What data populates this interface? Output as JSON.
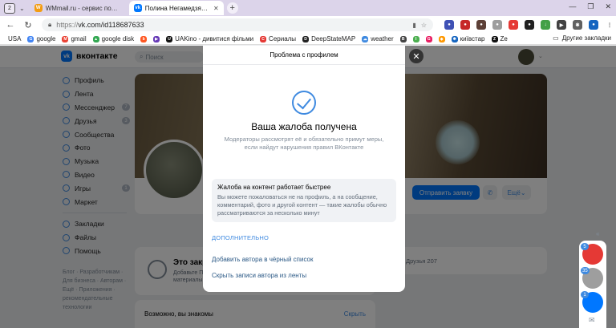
{
  "browser": {
    "tab_count": "2",
    "tabs": [
      {
        "title": "WMmail.ru - сервис почтового маркетинга",
        "fav_color": "#f39c12",
        "fav_glyph": "W"
      },
      {
        "title": "Полина Негамедзянова",
        "fav_color": "#0077ff",
        "fav_glyph": "vk"
      }
    ],
    "window": {
      "minimize": "—",
      "maximize": "❐",
      "close": "✕"
    },
    "address": {
      "prefix": "https://",
      "rest": "vk.com/id118687633"
    },
    "bookmarks": [
      {
        "label": "USA",
        "color": "#ffffff",
        "glyph": ""
      },
      {
        "label": "google",
        "color": "#4285f4",
        "glyph": "G"
      },
      {
        "label": "gmail",
        "color": "#ea4335",
        "glyph": "M"
      },
      {
        "label": "google disk",
        "color": "#34a853",
        "glyph": "▲"
      },
      {
        "label": "",
        "color": "#ff5722",
        "glyph": "b"
      },
      {
        "label": "",
        "color": "#673ab7",
        "glyph": "▶"
      },
      {
        "label": "UAKino - дивитися фільми",
        "color": "#111111",
        "glyph": "U"
      },
      {
        "label": "Сериалы",
        "color": "#e53935",
        "glyph": "С"
      },
      {
        "label": "DeepStateMAP",
        "color": "#222222",
        "glyph": "D"
      },
      {
        "label": "weather",
        "color": "#3f8ae0",
        "glyph": "☁"
      },
      {
        "label": "",
        "color": "#444444",
        "glyph": "B"
      },
      {
        "label": "",
        "color": "#4caf50",
        "glyph": "I"
      },
      {
        "label": "",
        "color": "#e91e63",
        "glyph": "G"
      },
      {
        "label": "",
        "color": "#ff9800",
        "glyph": "◆"
      },
      {
        "label": "",
        "color": "#9e9e9e",
        "glyph": "▣"
      },
      {
        "label": "київстар",
        "color": "#1565c0",
        "glyph": "✱"
      },
      {
        "label": "Ze",
        "color": "#111111",
        "glyph": "Z"
      }
    ],
    "other_bookmarks": "Другие закладки"
  },
  "vk": {
    "logo": "вконтакте",
    "search_placeholder": "Поиск",
    "menu": [
      {
        "label": "Профиль",
        "count": ""
      },
      {
        "label": "Лента",
        "count": ""
      },
      {
        "label": "Мессенджер",
        "count": "7"
      },
      {
        "label": "Друзья",
        "count": "3"
      },
      {
        "label": "Сообщества",
        "count": ""
      },
      {
        "label": "Фото",
        "count": ""
      },
      {
        "label": "Музыка",
        "count": ""
      },
      {
        "label": "Видео",
        "count": ""
      },
      {
        "label": "Игры",
        "count": "1"
      },
      {
        "label": "Маркет",
        "count": ""
      }
    ],
    "menu2": [
      {
        "label": "Закладки"
      },
      {
        "label": "Файлы"
      },
      {
        "label": "Помощь"
      }
    ],
    "footer": "Блог · Разработчикам · Для бизнеса · Авторам · Ещё · Приложения · рекомендательные технологии",
    "send_request": "Отправить заявку",
    "more": "Ещё",
    "block_title": "Это закрытый профиль",
    "block_text": "Добавьте Полину в друзья, чтобы смотреть её записи, фотографии и другие материалы",
    "friends_text": "Друзья 207",
    "maybe_title": "Возможно, вы знакомы",
    "maybe_link": "Скрыть"
  },
  "modal": {
    "header": "Проблема с профилем",
    "title": "Ваша жалоба получена",
    "subtitle": "Модераторы рассмотрят её и обязательно примут меры, если найдут нарушения правил ВКонтакте",
    "info_title": "Жалоба на контент работает быстрее",
    "info_text": "Вы можете пожаловаться не на профиль, а на сообщение, комментарий, фото и другой контент — такие жалобы обычно рассматриваются за несколько минут",
    "more": "Дополнительно",
    "link_blacklist": "Добавить автора в чёрный список",
    "link_hide": "Скрыть записи автора из ленты",
    "close": "✕"
  },
  "dock": {
    "badges": [
      "5",
      "35",
      "1"
    ],
    "colors": [
      "#e53935",
      "#9e9e9e",
      "#0077ff"
    ]
  }
}
